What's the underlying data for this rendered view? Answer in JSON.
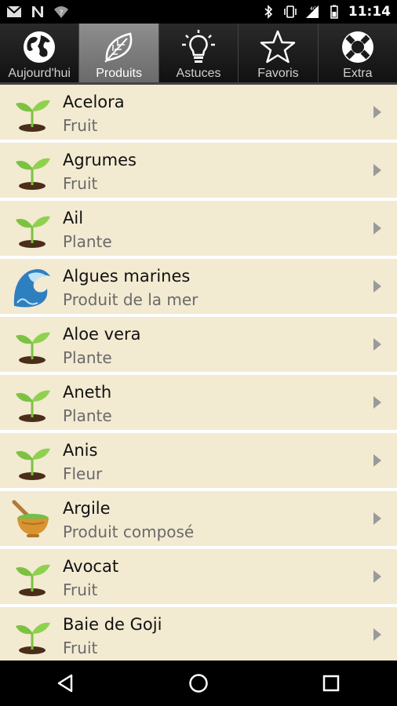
{
  "status_bar": {
    "time": "11:14",
    "network_label": "4G",
    "left_icons": [
      "gmail-icon",
      "n-icon",
      "wifi-question-icon"
    ],
    "right_icons": [
      "bluetooth-icon",
      "vibrate-icon",
      "signal-icon",
      "battery-icon"
    ]
  },
  "tabs": [
    {
      "label": "Aujourd'hui",
      "icon": "globe-icon",
      "active": false
    },
    {
      "label": "Produits",
      "icon": "leaf-icon",
      "active": true
    },
    {
      "label": "Astuces",
      "icon": "lightbulb-icon",
      "active": false
    },
    {
      "label": "Favoris",
      "icon": "star-icon",
      "active": false
    },
    {
      "label": "Extra",
      "icon": "lifebuoy-icon",
      "active": false
    }
  ],
  "items": [
    {
      "title": "Acelora",
      "subtitle": "Fruit",
      "icon": "sprout-icon"
    },
    {
      "title": "Agrumes",
      "subtitle": "Fruit",
      "icon": "sprout-icon"
    },
    {
      "title": "Ail",
      "subtitle": "Plante",
      "icon": "sprout-icon"
    },
    {
      "title": "Algues marines",
      "subtitle": "Produit de la mer",
      "icon": "wave-icon"
    },
    {
      "title": "Aloe vera",
      "subtitle": "Plante",
      "icon": "sprout-icon"
    },
    {
      "title": "Aneth",
      "subtitle": "Plante",
      "icon": "sprout-icon"
    },
    {
      "title": "Anis",
      "subtitle": "Fleur",
      "icon": "sprout-icon"
    },
    {
      "title": "Argile",
      "subtitle": "Produit composé",
      "icon": "mortar-icon"
    },
    {
      "title": "Avocat",
      "subtitle": "Fruit",
      "icon": "sprout-icon"
    },
    {
      "title": "Baie de Goji",
      "subtitle": "Fruit",
      "icon": "sprout-icon"
    }
  ],
  "nav": {
    "buttons": [
      "back-icon",
      "home-icon",
      "recents-icon"
    ]
  },
  "colors": {
    "row_background": "#f3ead2",
    "tab_active": "#7a7a7a",
    "tab_bar": "#1a1a1a",
    "sprout_green": "#7cc242"
  }
}
